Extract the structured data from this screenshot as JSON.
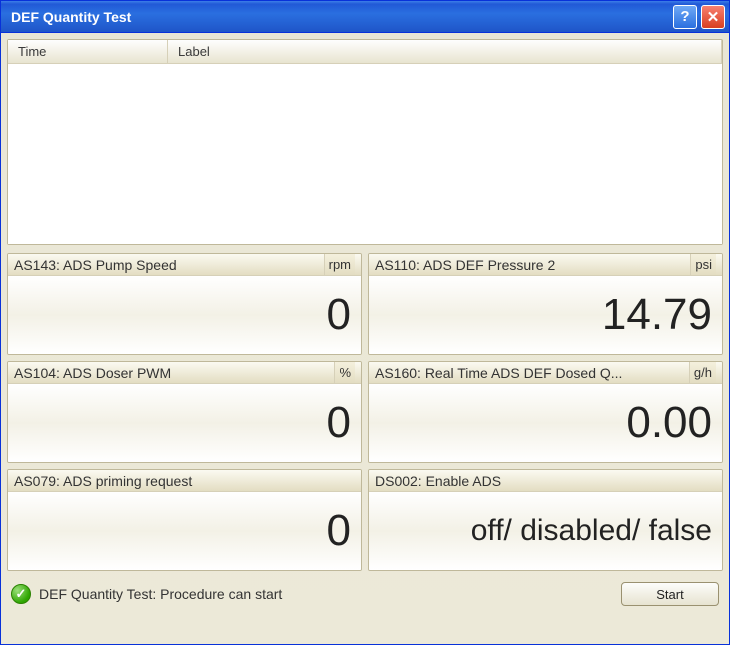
{
  "window": {
    "title": "DEF Quantity Test"
  },
  "list": {
    "cols": {
      "time": "Time",
      "label": "Label"
    }
  },
  "gauges": [
    {
      "label": "AS143: ADS Pump Speed",
      "unit": "rpm",
      "value": "0"
    },
    {
      "label": "AS110: ADS DEF Pressure 2",
      "unit": "psi",
      "value": "14.79"
    },
    {
      "label": "AS104: ADS Doser PWM",
      "unit": "%",
      "value": "0"
    },
    {
      "label": "AS160: Real Time ADS DEF Dosed Q...",
      "unit": "g/h",
      "value": "0.00"
    },
    {
      "label": "AS079: ADS priming request",
      "unit": "",
      "value": "0"
    },
    {
      "label": "DS002: Enable ADS",
      "unit": "",
      "value": "off/ disabled/ false",
      "text": true
    }
  ],
  "status": {
    "text": "DEF Quantity Test: Procedure can start",
    "button": "Start"
  }
}
